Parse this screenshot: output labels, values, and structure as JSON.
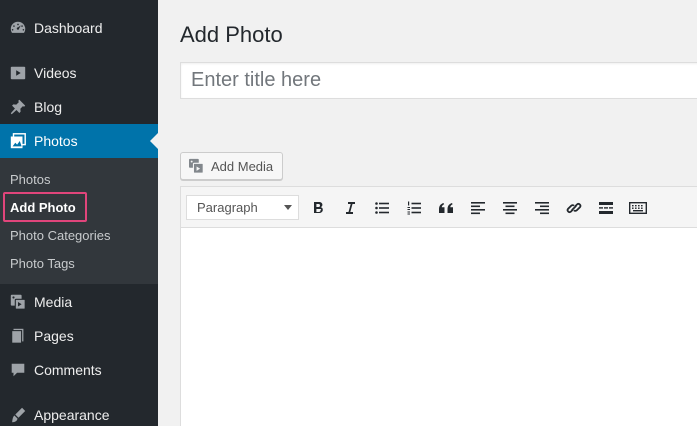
{
  "sidebar": {
    "items": [
      {
        "label": "Dashboard",
        "icon": "dashboard-icon"
      },
      {
        "label": "Videos",
        "icon": "video-icon"
      },
      {
        "label": "Blog",
        "icon": "pin-icon"
      },
      {
        "label": "Photos",
        "icon": "photos-icon"
      },
      {
        "label": "Media",
        "icon": "media-icon"
      },
      {
        "label": "Pages",
        "icon": "pages-icon"
      },
      {
        "label": "Comments",
        "icon": "comments-icon"
      },
      {
        "label": "Appearance",
        "icon": "appearance-icon"
      }
    ],
    "submenu": [
      {
        "label": "Photos"
      },
      {
        "label": "Add Photo"
      },
      {
        "label": "Photo Categories"
      },
      {
        "label": "Photo Tags"
      }
    ],
    "colors": {
      "background": "#23282d",
      "current": "#0073aa",
      "highlight": "#e0457b"
    }
  },
  "main": {
    "title": "Add Photo",
    "title_placeholder": "Enter title here",
    "add_media_label": "Add Media",
    "editor": {
      "format_value": "Paragraph",
      "toolbar": [
        "bold-icon",
        "italic-icon",
        "bullet-list-icon",
        "numbered-list-icon",
        "blockquote-icon",
        "align-left-icon",
        "align-center-icon",
        "align-right-icon",
        "link-icon",
        "read-more-icon",
        "toolbar-toggle-icon"
      ]
    }
  }
}
